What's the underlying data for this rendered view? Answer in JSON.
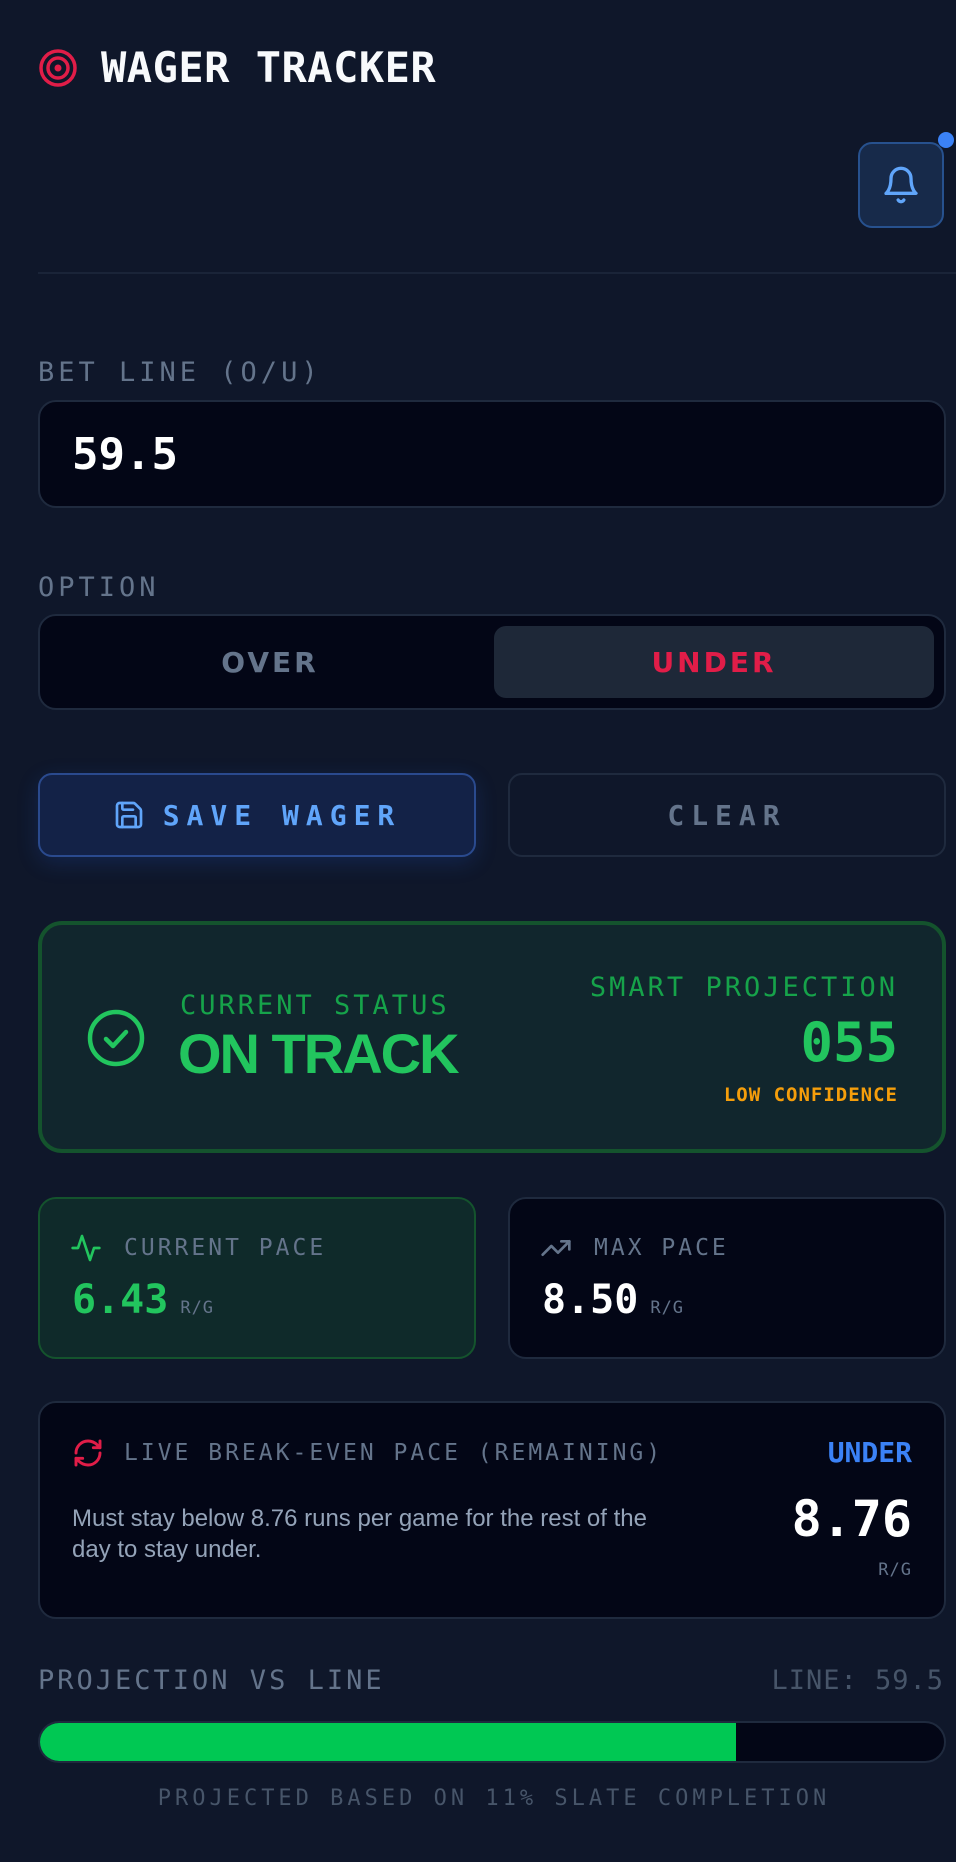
{
  "header": {
    "title": "WAGER TRACKER",
    "logo_icon": "target-icon",
    "bell_icon": "bell-icon"
  },
  "bet_line": {
    "label": "BET LINE (O/U)",
    "value": "59.5"
  },
  "option": {
    "label": "OPTION",
    "choices": [
      "OVER",
      "UNDER"
    ],
    "selected": "UNDER"
  },
  "actions": {
    "save_label": "SAVE WAGER",
    "clear_label": "CLEAR",
    "save_icon": "save-icon"
  },
  "status": {
    "label": "CURRENT STATUS",
    "value": "ON TRACK",
    "projection_label": "SMART PROJECTION",
    "projection_value": "055",
    "confidence": "LOW CONFIDENCE"
  },
  "pace": {
    "current_label": "CURRENT PACE",
    "current_value": "6.43",
    "max_label": "MAX PACE",
    "max_value": "8.50",
    "unit": "R/G"
  },
  "break_even": {
    "label": "LIVE BREAK-EVEN PACE (REMAINING)",
    "side": "UNDER",
    "description": "Must stay below 8.76 runs per game for the rest of the day to stay under.",
    "value": "8.76",
    "unit": "R/G"
  },
  "projection_vs_line": {
    "label": "PROJECTION VS LINE",
    "line_text": "LINE: 59.5",
    "progress_fraction": 0.77,
    "footnote": "PROJECTED BASED ON 11% SLATE COMPLETION"
  },
  "colors": {
    "background": "#0f172a",
    "accent_blue": "#3b82f6",
    "accent_red": "#e11d48",
    "accent_green": "#22c55e",
    "warning": "#f59e0b"
  }
}
